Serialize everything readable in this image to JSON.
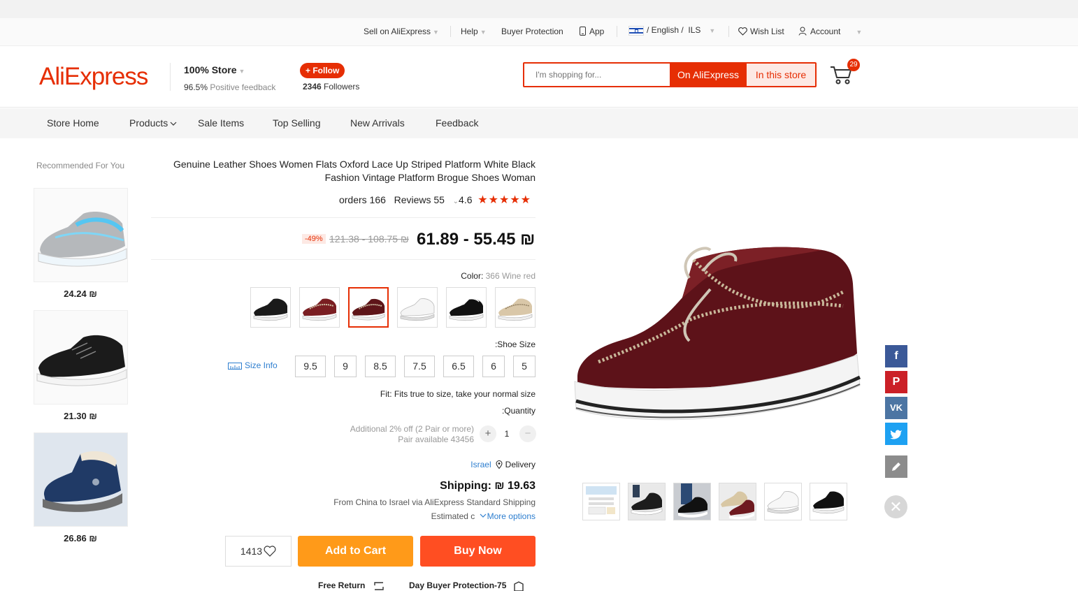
{
  "topbar": {
    "sell": "Sell on AliExpress",
    "help": "Help",
    "buyer_protection": "Buyer Protection",
    "app": "App",
    "language": "/ English /",
    "currency": "ILS",
    "wishlist": "Wish List",
    "account": "Account"
  },
  "header": {
    "logo": "AliExpress",
    "store_name": "100% Store",
    "feedback_pct": "96.5%",
    "feedback_label": "Positive feedback",
    "follow": "+ Follow",
    "followers_count": "2346",
    "followers_label": "Followers",
    "search_placeholder": "I'm shopping for...",
    "search_on_ali": "On AliExpress",
    "search_in_store": "In this store",
    "cart_count": "29"
  },
  "nav": [
    "Store Home",
    "Products",
    "Sale Items",
    "Top Selling",
    "New Arrivals",
    "Feedback"
  ],
  "recommended": {
    "title": "Recommended For You",
    "items": [
      {
        "price": "24.24 ₪"
      },
      {
        "price": "21.30 ₪"
      },
      {
        "price": "26.86 ₪"
      }
    ]
  },
  "product": {
    "title": "Genuine Leather Shoes Women Flats Oxford Lace Up Striped Platform White Black Fashion Vintage Platform Brogue Shoes Woman",
    "orders": "orders 166",
    "reviews": "Reviews 55",
    "rating": "4.6",
    "stars": "★★★★★",
    "discount": "-49%",
    "old_price": "121.38 - 108.75 ₪",
    "price": "61.89 - 55.45 ₪",
    "color_label": "Color:",
    "color_value": "366 Wine red",
    "size_label": ":Shoe Size",
    "size_info": "Size Info",
    "sizes": [
      "9.5",
      "9",
      "8.5",
      "7.5",
      "6.5",
      "6",
      "5"
    ],
    "fit": "Fit: Fits true to size, take your normal size",
    "quantity_label": ":Quantity",
    "additional_off": "Additional 2% off (2 Pair or more)",
    "pair_available": "Pair available 43456",
    "quantity": "1",
    "delivery_country": "Israel",
    "delivery_label": "Delivery",
    "shipping": "Shipping: ₪ 19.63",
    "shipping_route": "From China to Israel via AliExpress Standard Shipping",
    "estimated": "Estimated c",
    "more_options": "More options",
    "wish_count": "1413",
    "add_to_cart": "Add to Cart",
    "buy_now": "Buy Now",
    "free_return": "Free Return",
    "buyer_protection": "Day Buyer Protection-75"
  },
  "colors": {
    "accent": "#e62e04",
    "add_to_cart": "#ff9a19",
    "buy_now": "#ff4e22",
    "link": "#2d7ecf"
  },
  "icons": [
    "phone-icon",
    "flag-israel-icon",
    "heart-icon",
    "user-icon",
    "cart-icon",
    "ruler-icon",
    "location-pin-icon",
    "chevron-down-icon",
    "facebook-icon",
    "pinterest-icon",
    "vk-icon",
    "twitter-icon",
    "edit-icon",
    "close-icon"
  ]
}
